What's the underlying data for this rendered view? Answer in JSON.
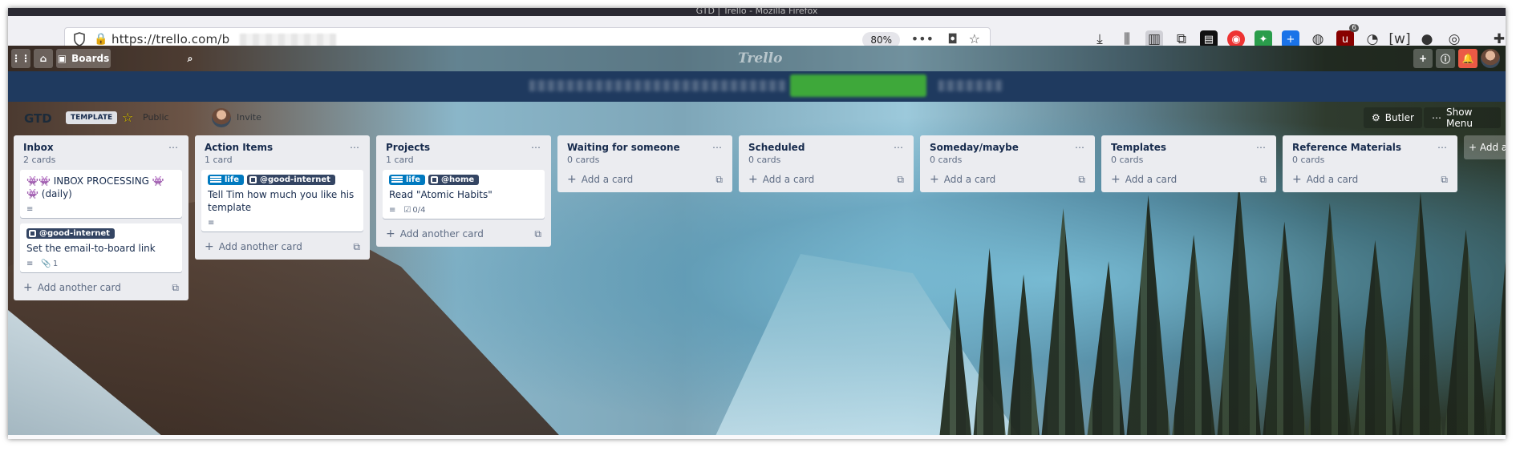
{
  "browser": {
    "window_title": "GTD | Trello - Mozilla Firefox",
    "url": "https://trello.com/b",
    "zoom": "80%"
  },
  "trello": {
    "boards_label": "Boards",
    "logo": "Trello"
  },
  "board": {
    "title": "GTD",
    "template_badge": "TEMPLATE",
    "visibility": "Public",
    "member": "Invite",
    "butler": "Butler",
    "show_menu": "Show Menu",
    "add_list": "+ Add a"
  },
  "lists": [
    {
      "title": "Inbox",
      "count": "2 cards",
      "add": "Add another card",
      "cards": [
        {
          "title": "👾👾 INBOX PROCESSING 👾👾 (daily)",
          "labels": [],
          "badges": {
            "description": true
          }
        },
        {
          "title": "Set the email-to-board link",
          "labels": [
            {
              "text": "@good-internet",
              "color": "#344563"
            }
          ],
          "badges": {
            "description": true,
            "attachments": "1"
          }
        }
      ]
    },
    {
      "title": "Action Items",
      "count": "1 card",
      "add": "Add another card",
      "cards": [
        {
          "title": "Tell Tim how much you like his template",
          "labels": [
            {
              "text": "life",
              "color": "#0079bf"
            },
            {
              "text": "@good-internet",
              "color": "#344563"
            }
          ],
          "badges": {
            "description": true
          }
        }
      ]
    },
    {
      "title": "Projects",
      "count": "1 card",
      "add": "Add another card",
      "cards": [
        {
          "title": "Read \"Atomic Habits\"",
          "labels": [
            {
              "text": "life",
              "color": "#0079bf"
            },
            {
              "text": "@home",
              "color": "#344563"
            }
          ],
          "badges": {
            "description": true,
            "checklist": "0/4"
          }
        }
      ]
    },
    {
      "title": "Waiting for someone",
      "count": "0 cards",
      "add": "Add a card",
      "cards": []
    },
    {
      "title": "Scheduled",
      "count": "0 cards",
      "add": "Add a card",
      "cards": []
    },
    {
      "title": "Someday/maybe",
      "count": "0 cards",
      "add": "Add a card",
      "cards": []
    },
    {
      "title": "Templates",
      "count": "0 cards",
      "add": "Add a card",
      "cards": []
    },
    {
      "title": "Reference Materials",
      "count": "0 cards",
      "add": "Add a card",
      "cards": []
    }
  ],
  "colors": {
    "banner": "#1f3a5f",
    "list_bg": "#ebecf0",
    "label_blue": "#0079bf",
    "label_dark": "#344563",
    "notification_red": "#eb5a46"
  }
}
